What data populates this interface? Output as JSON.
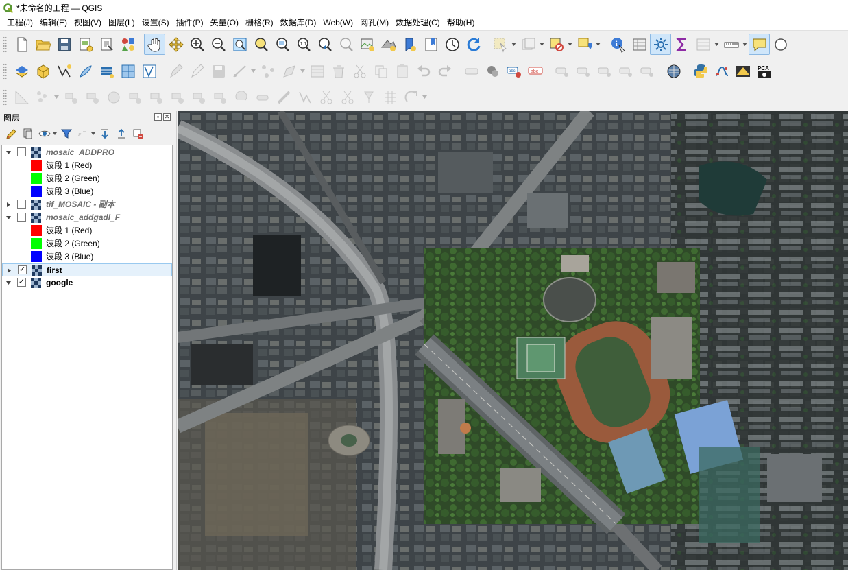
{
  "window": {
    "title": "*未命名的工程 — QGIS"
  },
  "menu": [
    {
      "id": "project",
      "label": "工程(J)"
    },
    {
      "id": "edit",
      "label": "编辑(E)"
    },
    {
      "id": "view",
      "label": "视图(V)"
    },
    {
      "id": "layer",
      "label": "图层(L)"
    },
    {
      "id": "settings",
      "label": "设置(S)"
    },
    {
      "id": "plugins",
      "label": "插件(P)"
    },
    {
      "id": "vector",
      "label": "矢量(O)"
    },
    {
      "id": "raster",
      "label": "栅格(R)"
    },
    {
      "id": "database",
      "label": "数据库(D)"
    },
    {
      "id": "web",
      "label": "Web(W)"
    },
    {
      "id": "mesh",
      "label": "网孔(M)"
    },
    {
      "id": "processing",
      "label": "数据处理(C)"
    },
    {
      "id": "help",
      "label": "帮助(H)"
    }
  ],
  "toolbar_icons": {
    "row1": [
      "new-project-icon",
      "open-project-icon",
      "save-project-icon",
      "new-print-layout-icon",
      "layout-manager-icon",
      "style-manager-icon",
      "pan-icon",
      "pan-to-selection-icon",
      "zoom-in-icon",
      "zoom-out-icon",
      "zoom-full-icon",
      "zoom-to-selection-icon",
      "zoom-to-layer-icon",
      "zoom-native-icon",
      "zoom-last-icon",
      "zoom-next-icon",
      "new-map-view-icon",
      "new-3d-map-icon",
      "new-bookmark-icon",
      "show-bookmarks-icon",
      "temporal-controller-icon",
      "refresh-icon",
      "select-features-icon",
      "deselect-icon",
      "attribute-table-icon",
      "identify-icon",
      "toolbox-icon",
      "settings-gear-icon",
      "statistics-sum-icon",
      "measure-icon",
      "map-tips-icon"
    ],
    "row2": [
      "data-source-manager-icon",
      "new-geopackage-layer-icon",
      "new-shapefile-layer-icon",
      "new-temporary-layer-icon",
      "new-spatialite-layer-icon",
      "new-virtual-layer-icon",
      "digitize-icon",
      "toggle-editing-icon",
      "save-edits-icon",
      "add-feature-icon",
      "vertex-tool-icon",
      "modify-attributes-icon",
      "delete-selected-icon",
      "cut-features-icon",
      "copy-features-icon",
      "paste-features-icon",
      "undo-icon",
      "redo-icon",
      "label-icon",
      "pin-labels-icon",
      "highlight-labels-icon",
      "change-label-icon",
      "python-console-icon",
      "trend-icon",
      "geo-icon",
      "pca-icon"
    ],
    "row3": [
      "digitize-curve-icon",
      "add-ring-icon",
      "add-part-icon",
      "fill-ring-icon",
      "delete-ring-icon",
      "delete-part-icon",
      "reshape-icon",
      "offset-curve-icon",
      "split-features-icon",
      "merge-features-icon",
      "rotate-point-icon"
    ]
  },
  "layers_panel": {
    "title": "图层",
    "tools": [
      "open-styling-icon",
      "add-group-icon",
      "manage-visibility-icon",
      "filter-legend-icon",
      "filter-by-expression-icon",
      "expand-all-icon",
      "collapse-all-icon",
      "remove-layer-icon"
    ],
    "layers": [
      {
        "name": "mosaic_ADDPRO",
        "checked": false,
        "expanded": true,
        "style": "italic",
        "bands": [
          {
            "label": "波段 1 (Red)",
            "color": "#ff0000"
          },
          {
            "label": "波段 2 (Green)",
            "color": "#00ff00"
          },
          {
            "label": "波段 3 (Blue)",
            "color": "#0000ff"
          }
        ]
      },
      {
        "name": "tif_MOSAIC - 副本",
        "checked": false,
        "expanded": false,
        "style": "italic",
        "bands": []
      },
      {
        "name": "mosaic_addgadl_F",
        "checked": false,
        "expanded": true,
        "style": "italic",
        "bands": [
          {
            "label": "波段 1 (Red)",
            "color": "#ff0000"
          },
          {
            "label": "波段 2 (Green)",
            "color": "#00ff00"
          },
          {
            "label": "波段 3 (Blue)",
            "color": "#0000ff"
          }
        ]
      },
      {
        "name": "first",
        "checked": true,
        "expanded": false,
        "style": "bold-underline",
        "selected": true,
        "bands": []
      },
      {
        "name": "google",
        "checked": true,
        "expanded": true,
        "style": "bold",
        "bands": []
      }
    ]
  },
  "map": {
    "description_icon": "satellite-imagery"
  }
}
